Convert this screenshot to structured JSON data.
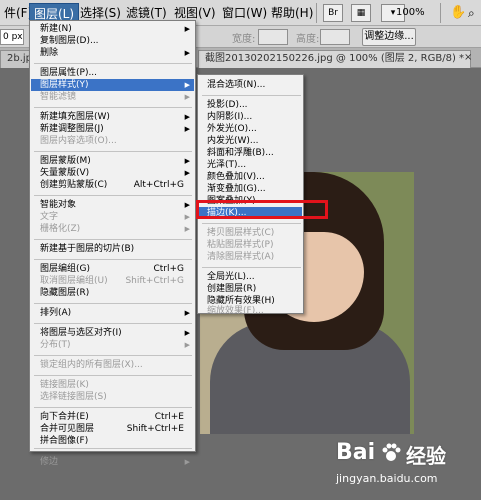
{
  "menubar": {
    "items": [
      {
        "label": "件(F)"
      },
      {
        "label": "图层(L)"
      },
      {
        "label": "选择(S)"
      },
      {
        "label": "滤镜(T)"
      },
      {
        "label": "视图(V)"
      },
      {
        "label": "窗口(W)"
      },
      {
        "label": "帮助(H)"
      }
    ],
    "zoom": "100%",
    "br_label": "Br"
  },
  "options": {
    "feather_value": "0 px",
    "width_label": "宽度:",
    "height_label": "高度:",
    "refine_edge_button": "调整边缘..."
  },
  "tabs": {
    "left_tab": "2b.jpg",
    "doc_tab": "截图20130202150226.jpg @ 100% (图层 2, RGB/8) *"
  },
  "layer_menu": {
    "items": [
      {
        "label": "新建(N)",
        "shortcut": "",
        "arrow": true,
        "disabled": false
      },
      {
        "label": "复制图层(D)...",
        "shortcut": "",
        "arrow": false,
        "disabled": false
      },
      {
        "label": "删除",
        "shortcut": "",
        "arrow": true,
        "disabled": false
      },
      {
        "label": "图层属性(P)...",
        "shortcut": "",
        "arrow": false,
        "disabled": false
      },
      {
        "label": "图层样式(Y)",
        "shortcut": "",
        "arrow": true,
        "disabled": false,
        "highlight": true
      },
      {
        "label": "智能滤镜",
        "shortcut": "",
        "arrow": true,
        "disabled": true
      },
      {
        "label": "新建填充图层(W)",
        "shortcut": "",
        "arrow": true,
        "disabled": false
      },
      {
        "label": "新建调整图层(J)",
        "shortcut": "",
        "arrow": true,
        "disabled": false
      },
      {
        "label": "图层内容选项(O)...",
        "shortcut": "",
        "arrow": false,
        "disabled": true
      },
      {
        "label": "图层蒙版(M)",
        "shortcut": "",
        "arrow": true,
        "disabled": false
      },
      {
        "label": "矢量蒙版(V)",
        "shortcut": "",
        "arrow": true,
        "disabled": false
      },
      {
        "label": "创建剪贴蒙版(C)",
        "shortcut": "Alt+Ctrl+G",
        "arrow": false,
        "disabled": false
      },
      {
        "label": "智能对象",
        "shortcut": "",
        "arrow": true,
        "disabled": false
      },
      {
        "label": "文字",
        "shortcut": "",
        "arrow": true,
        "disabled": true
      },
      {
        "label": "栅格化(Z)",
        "shortcut": "",
        "arrow": true,
        "disabled": true
      },
      {
        "label": "新建基于图层的切片(B)",
        "shortcut": "",
        "arrow": false,
        "disabled": false
      },
      {
        "label": "图层编组(G)",
        "shortcut": "Ctrl+G",
        "arrow": false,
        "disabled": false
      },
      {
        "label": "取消图层编组(U)",
        "shortcut": "Shift+Ctrl+G",
        "arrow": false,
        "disabled": true
      },
      {
        "label": "隐藏图层(R)",
        "shortcut": "",
        "arrow": false,
        "disabled": false
      },
      {
        "label": "排列(A)",
        "shortcut": "",
        "arrow": true,
        "disabled": false
      },
      {
        "label": "将图层与选区对齐(I)",
        "shortcut": "",
        "arrow": true,
        "disabled": false
      },
      {
        "label": "分布(T)",
        "shortcut": "",
        "arrow": true,
        "disabled": true
      },
      {
        "label": "锁定组内的所有图层(X)...",
        "shortcut": "",
        "arrow": false,
        "disabled": true
      },
      {
        "label": "链接图层(K)",
        "shortcut": "",
        "arrow": false,
        "disabled": true
      },
      {
        "label": "选择链接图层(S)",
        "shortcut": "",
        "arrow": false,
        "disabled": true
      },
      {
        "label": "向下合并(E)",
        "shortcut": "Ctrl+E",
        "arrow": false,
        "disabled": false
      },
      {
        "label": "合并可见图层",
        "shortcut": "Shift+Ctrl+E",
        "arrow": false,
        "disabled": false
      },
      {
        "label": "拼合图像(F)",
        "shortcut": "",
        "arrow": false,
        "disabled": false
      },
      {
        "label": "修边",
        "shortcut": "",
        "arrow": true,
        "disabled": true
      }
    ]
  },
  "style_submenu": {
    "items": [
      {
        "label": "混合选项(N)...",
        "disabled": false
      },
      {
        "label": "投影(D)...",
        "disabled": false
      },
      {
        "label": "内阴影(I)...",
        "disabled": false
      },
      {
        "label": "外发光(O)...",
        "disabled": false
      },
      {
        "label": "内发光(W)...",
        "disabled": false
      },
      {
        "label": "斜面和浮雕(B)...",
        "disabled": false
      },
      {
        "label": "光泽(T)...",
        "disabled": false
      },
      {
        "label": "颜色叠加(V)...",
        "disabled": false
      },
      {
        "label": "渐变叠加(G)...",
        "disabled": false
      },
      {
        "label": "图案叠加(Y)...",
        "disabled": false
      },
      {
        "label": "描边(K)...",
        "disabled": false,
        "highlight": true
      },
      {
        "label": "拷贝图层样式(C)",
        "disabled": true
      },
      {
        "label": "粘贴图层样式(P)",
        "disabled": true
      },
      {
        "label": "清除图层样式(A)",
        "disabled": true
      },
      {
        "label": "全局光(L)...",
        "disabled": false
      },
      {
        "label": "创建图层(R)",
        "disabled": false
      },
      {
        "label": "隐藏所有效果(H)",
        "disabled": false
      },
      {
        "label": "缩放效果(F)...",
        "disabled": true
      }
    ]
  },
  "watermark": {
    "brand": "Bai",
    "brand_suffix": "经验",
    "url": "jingyan.baidu.com"
  }
}
